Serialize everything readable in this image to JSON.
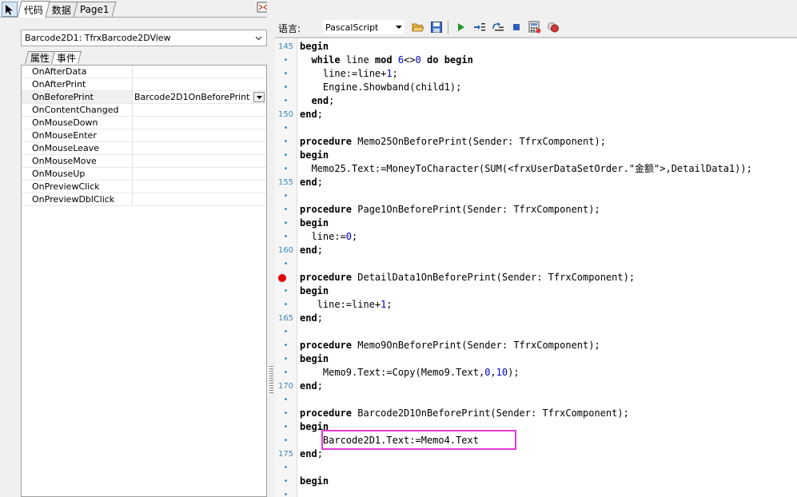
{
  "tabs": {
    "code": "代码",
    "data": "数据",
    "page1": "Page1"
  },
  "object_selector": {
    "value": "Barcode2D1: TfrxBarcode2DView"
  },
  "inspector_tabs": {
    "properties": "属性",
    "events": "事件"
  },
  "events": [
    {
      "name": "OnAfterData",
      "value": ""
    },
    {
      "name": "OnAfterPrint",
      "value": ""
    },
    {
      "name": "OnBeforePrint",
      "value": "Barcode2D1OnBeforePrint"
    },
    {
      "name": "OnContentChanged",
      "value": ""
    },
    {
      "name": "OnMouseDown",
      "value": ""
    },
    {
      "name": "OnMouseEnter",
      "value": ""
    },
    {
      "name": "OnMouseLeave",
      "value": ""
    },
    {
      "name": "OnMouseMove",
      "value": ""
    },
    {
      "name": "OnMouseUp",
      "value": ""
    },
    {
      "name": "OnPreviewClick",
      "value": ""
    },
    {
      "name": "OnPreviewDblClick",
      "value": ""
    }
  ],
  "toolbar": {
    "language_label": "语言:",
    "language_value": "PascalScript"
  },
  "gutter": {
    "145": "145",
    "150": "150",
    "155": "155",
    "160": "160",
    "165": "165",
    "170": "170",
    "175": "175"
  },
  "code": [
    "begin",
    "  while line mod 6<>0 do begin",
    "    line:=line+1;",
    "    Engine.Showband(child1);",
    "  end;",
    "end;",
    "",
    "procedure Memo25OnBeforePrint(Sender: TfrxComponent);",
    "begin",
    "  Memo25.Text:=MoneyToCharacter(SUM(<frxUserDataSetOrder.\"金额\">,DetailData1));",
    "end;",
    "",
    "procedure Page1OnBeforePrint(Sender: TfrxComponent);",
    "begin",
    "  line:=0;",
    "end;",
    "",
    "procedure DetailData1OnBeforePrint(Sender: TfrxComponent);",
    "begin",
    "   line:=line+1;",
    "end;",
    "",
    "procedure Memo9OnBeforePrint(Sender: TfrxComponent);",
    "begin",
    "    Memo9.Text:=Copy(Memo9.Text,0,10);",
    "end;",
    "",
    "procedure Barcode2D1OnBeforePrint(Sender: TfrxComponent);",
    "begin",
    "    Barcode2D1.Text:=Memo4.Text",
    "end;",
    "",
    "begin"
  ],
  "colors": {
    "highlight_box": "#e83ad8",
    "breakpoint": "#e00000",
    "line_numbers": "#3a8ab0"
  }
}
